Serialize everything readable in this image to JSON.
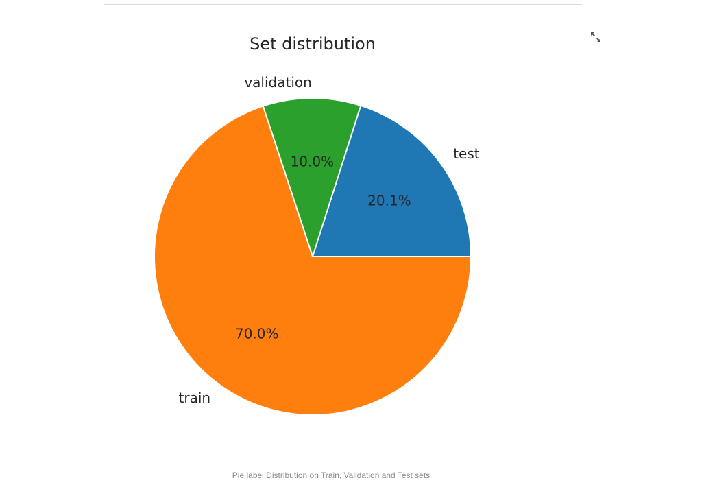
{
  "chart_data": {
    "type": "pie",
    "title": "Set distribution",
    "slices": [
      {
        "label": "test",
        "value": 20.1,
        "pct_label": "20.1%",
        "color": "#1f77b4"
      },
      {
        "label": "validation",
        "value": 10.0,
        "pct_label": "10.0%",
        "color": "#2ca02c"
      },
      {
        "label": "train",
        "value": 70.0,
        "pct_label": "70.0%",
        "color": "#ff7f0e"
      }
    ],
    "start_angle_deg": 0,
    "direction": "counterclockwise",
    "edge_color": "#ffffff"
  },
  "caption": "Pie label Distribution on Train, Validation and Test sets",
  "toolbar": {
    "fullscreen_icon": "expand-icon"
  }
}
